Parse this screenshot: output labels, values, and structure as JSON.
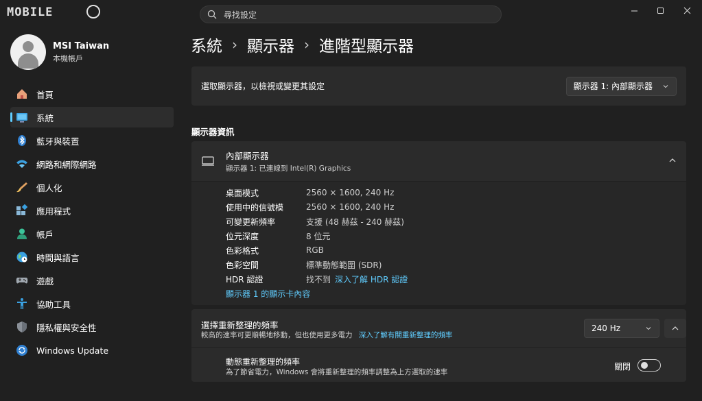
{
  "app": {
    "logo_text": "MOBILE"
  },
  "search": {
    "placeholder": "尋找設定"
  },
  "window": {
    "minimize": "minimize",
    "maximize": "maximize",
    "close": "close"
  },
  "profile": {
    "name": "MSI Taiwan",
    "account": "本機帳戶"
  },
  "sidebar": {
    "items": [
      {
        "label": "首頁",
        "icon": "home-icon",
        "active": false
      },
      {
        "label": "系統",
        "icon": "system-icon",
        "active": true
      },
      {
        "label": "藍牙與裝置",
        "icon": "bluetooth-icon",
        "active": false
      },
      {
        "label": "網路和網際網路",
        "icon": "wifi-icon",
        "active": false
      },
      {
        "label": "個人化",
        "icon": "brush-icon",
        "active": false
      },
      {
        "label": "應用程式",
        "icon": "apps-icon",
        "active": false
      },
      {
        "label": "帳戶",
        "icon": "account-icon",
        "active": false
      },
      {
        "label": "時間與語言",
        "icon": "globe-icon",
        "active": false
      },
      {
        "label": "遊戲",
        "icon": "gamepad-icon",
        "active": false
      },
      {
        "label": "協助工具",
        "icon": "accessibility-icon",
        "active": false
      },
      {
        "label": "隱私權與安全性",
        "icon": "shield-icon",
        "active": false
      },
      {
        "label": "Windows Update",
        "icon": "update-icon",
        "active": false
      }
    ]
  },
  "breadcrumb": {
    "part1": "系統",
    "part2": "顯示器",
    "part3": "進階型顯示器",
    "separator": "›"
  },
  "display_select": {
    "label": "選取顯示器，以檢視或變更其設定",
    "value": "顯示器 1: 內部顯示器"
  },
  "section": {
    "title": "顯示器資訊"
  },
  "monitor": {
    "name": "內部顯示器",
    "connection": "顯示器 1: 已連線到 Intel(R) Graphics"
  },
  "info": {
    "rows": [
      {
        "key": "桌面模式",
        "value": "2560 × 1600, 240 Hz"
      },
      {
        "key": "使用中的信號模",
        "value": "2560 × 1600, 240 Hz"
      },
      {
        "key": "可變更新頻率",
        "value": "支援 (48 赫茲 - 240 赫茲)"
      },
      {
        "key": "位元深度",
        "value": "8 位元"
      },
      {
        "key": "色彩格式",
        "value": "RGB"
      },
      {
        "key": "色彩空間",
        "value": "標準動態範圍 (SDR)"
      }
    ],
    "hdr_key": "HDR 認證",
    "hdr_value": "找不到",
    "hdr_link": "深入了解 HDR 認證",
    "adapter_link": "顯示器 1 的顯示卡內容"
  },
  "refresh": {
    "title": "選擇重新整理的頻率",
    "desc": "較高的速率可更順暢地移動，但也使用更多電力",
    "desc_link": "深入了解有關重新整理的頻率",
    "value": "240 Hz"
  },
  "dynamic": {
    "title": "動態重新整理的頻率",
    "desc": "為了節省電力，Windows 會將重新整理的頻率調整為上方選取的速率",
    "state": "關閉"
  },
  "colors": {
    "accent": "#60cdff",
    "background": "#202020",
    "card": "#2b2b2b"
  }
}
